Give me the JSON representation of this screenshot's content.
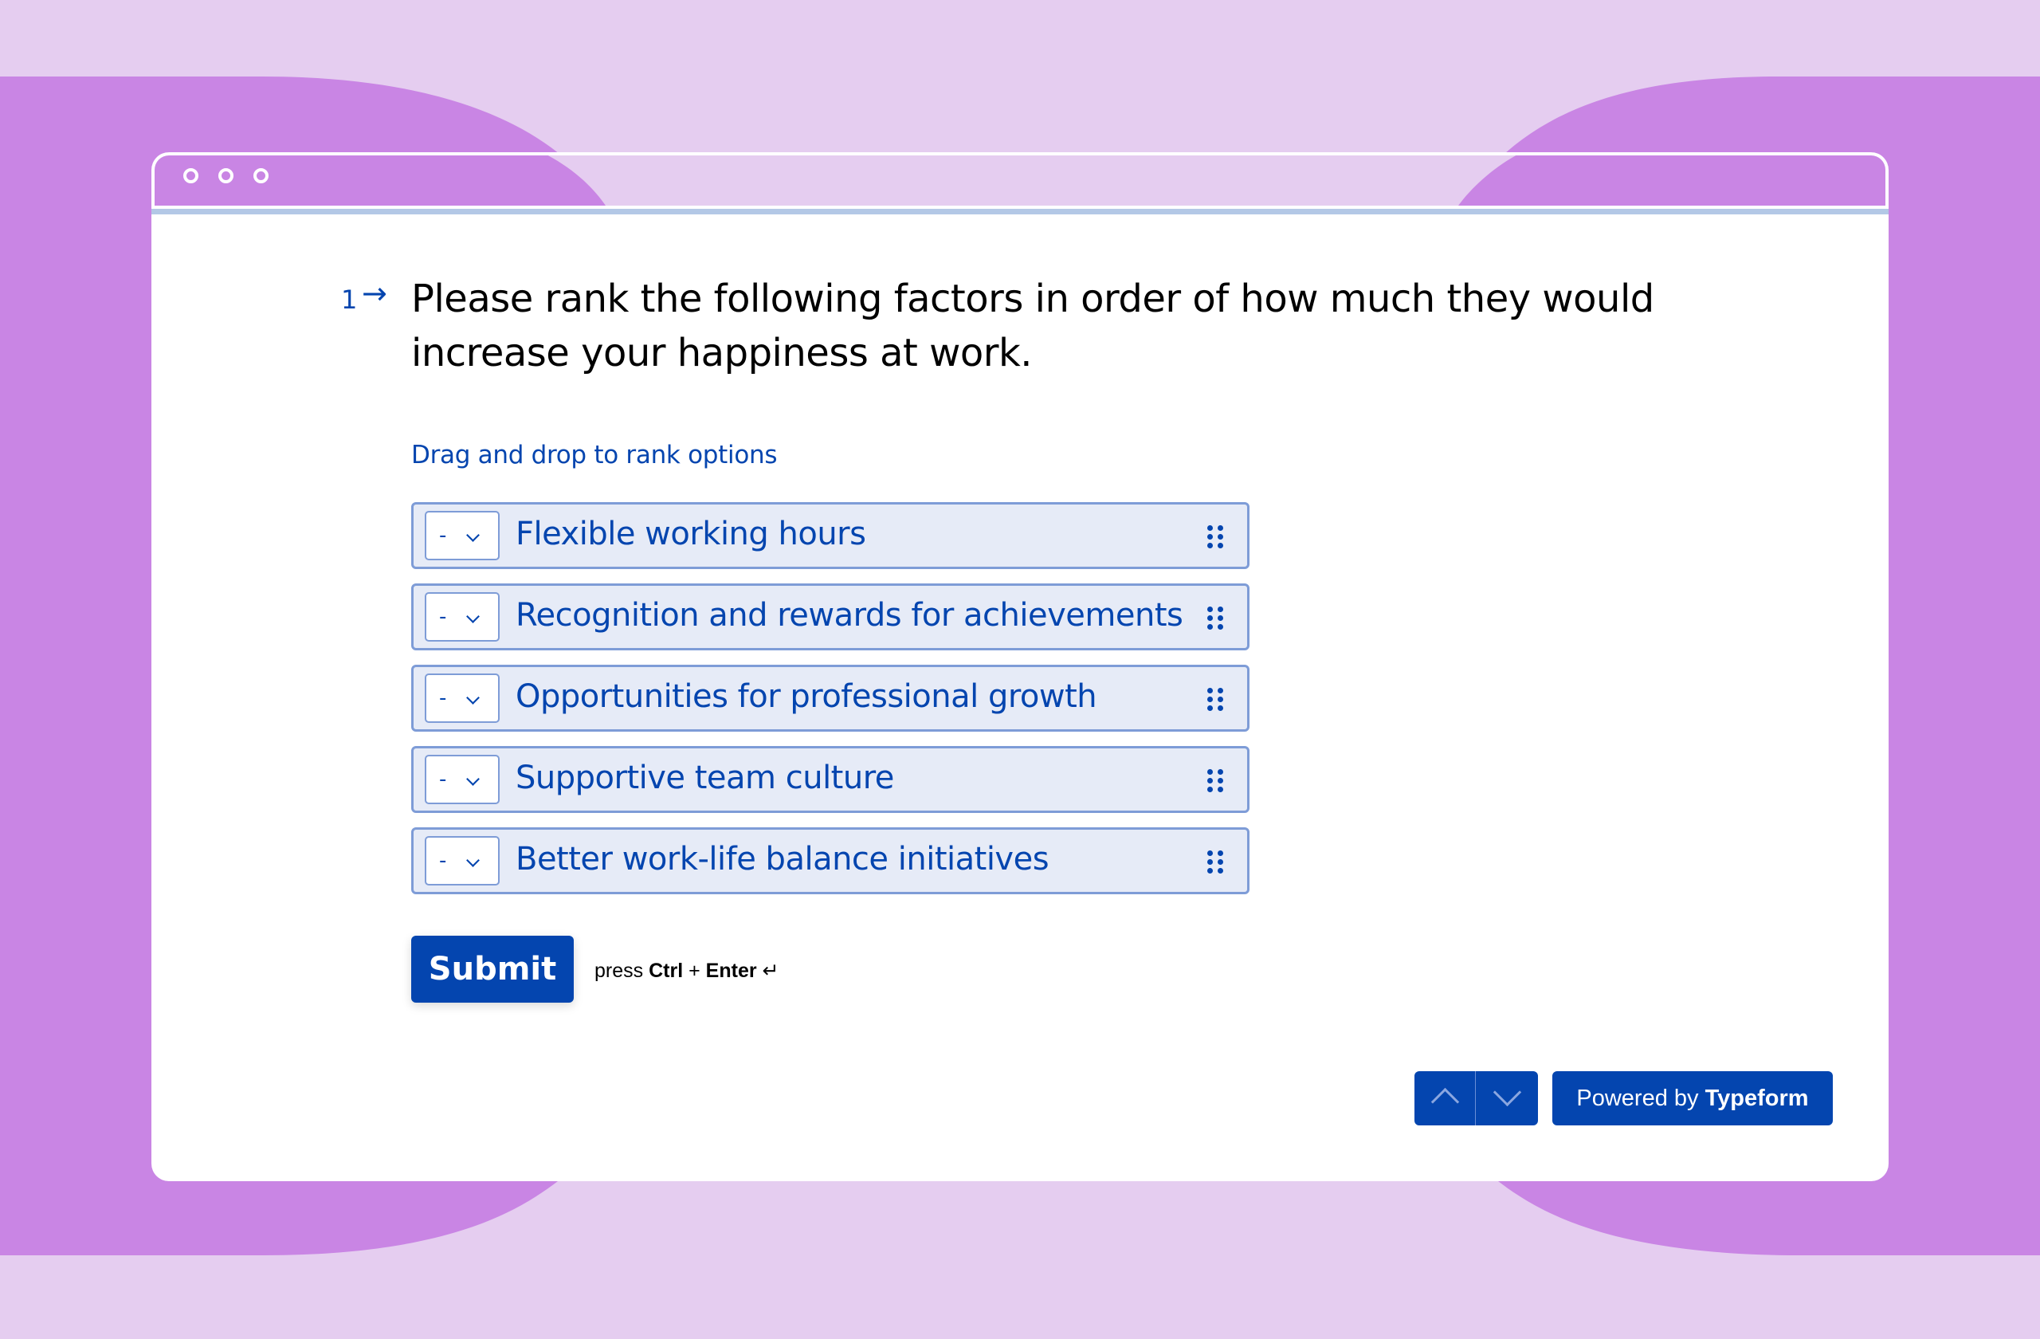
{
  "window": {
    "controls": [
      "window-dot",
      "window-dot",
      "window-dot"
    ]
  },
  "colors": {
    "accent": "#0445AF",
    "background_light": "#E5CDF0",
    "background_purple": "#C985E4",
    "option_fill": "#E6EBF7",
    "option_border": "#7E9CD7",
    "divider_blue": "#B3C8E6"
  },
  "question": {
    "number": "1",
    "arrow_icon": "arrow-right-icon",
    "text": "Please rank the following factors in order of how much they would increase your happiness at work."
  },
  "instructions": "Drag and drop to rank options",
  "options": [
    {
      "rank": "-",
      "label": "Flexible working hours"
    },
    {
      "rank": "-",
      "label": "Recognition and rewards for achievements"
    },
    {
      "rank": "-",
      "label": "Opportunities for professional growth"
    },
    {
      "rank": "-",
      "label": "Supportive team culture"
    },
    {
      "rank": "-",
      "label": "Better work-life balance initiatives"
    }
  ],
  "submit": {
    "label": "Submit",
    "hint_prefix": "press",
    "hint_key1": "Ctrl",
    "hint_plus": "+",
    "hint_key2": "Enter",
    "hint_icon": "↵"
  },
  "footer": {
    "nav_up_icon": "chevron-up-icon",
    "nav_down_icon": "chevron-down-icon",
    "powered_prefix": "Powered by",
    "powered_brand": "Typeform"
  }
}
